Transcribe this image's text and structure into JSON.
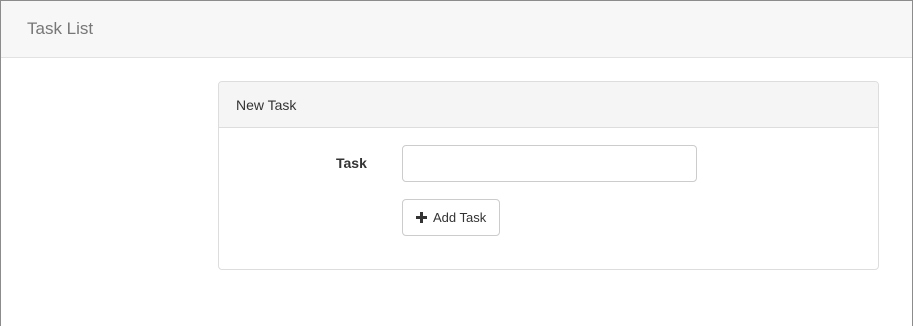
{
  "navbar": {
    "title": "Task List"
  },
  "panel": {
    "heading": "New Task",
    "task_label": "Task",
    "task_input_value": "",
    "task_input_placeholder": "",
    "add_button_label": "Add Task",
    "add_button_icon": "plus-icon"
  }
}
